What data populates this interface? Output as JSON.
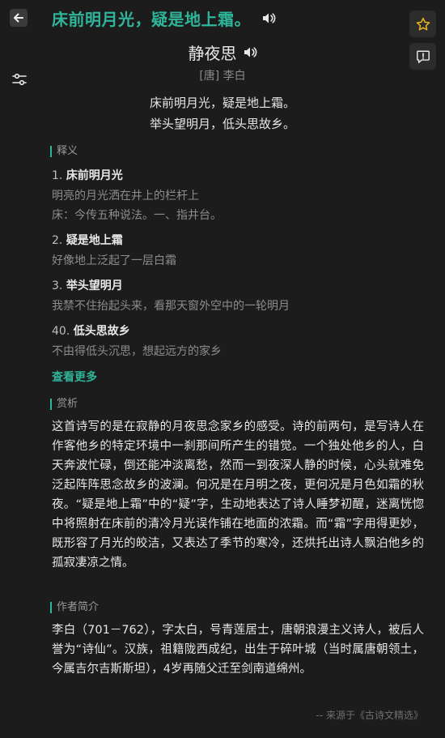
{
  "header": {
    "headline": "床前明月光，疑是地上霜。"
  },
  "poem": {
    "title": "静夜思",
    "author": "[唐] 李白",
    "lines": [
      "床前明月光，疑是地上霜。",
      "举头望明月，低头思故乡。"
    ]
  },
  "definitions": {
    "heading": "释义",
    "items": [
      {
        "num": "1.",
        "word": "床前明月光",
        "text": [
          "明亮的月光洒在井上的栏杆上",
          "床：今传五种说法。一、指井台。"
        ]
      },
      {
        "num": "2.",
        "word": "疑是地上霜",
        "text": [
          "好像地上泛起了一层白霜"
        ]
      },
      {
        "num": "3.",
        "word": "举头望明月",
        "text": [
          "我禁不住抬起头来，看那天窗外空中的一轮明月"
        ]
      },
      {
        "num": "40.",
        "word": "低头思故乡",
        "text": [
          "不由得低头沉思，想起远方的家乡"
        ]
      }
    ],
    "more_label": "查看更多"
  },
  "appreciation": {
    "heading": "赏析",
    "text": "这首诗写的是在寂静的月夜思念家乡的感受。诗的前两句，是写诗人在作客他乡的特定环境中一刹那间所产生的错觉。一个独处他乡的人，白天奔波忙碌，倒还能冲淡离愁，然而一到夜深人静的时候，心头就难免泛起阵阵思念故乡的波澜。何况是在月明之夜，更何况是月色如霜的秋夜。“疑是地上霜”中的“疑”字，生动地表达了诗人睡梦初醒，迷离恍惚中将照射在床前的清冷月光误作铺在地面的浓霜。而“霜”字用得更妙，既形容了月光的皎洁，又表达了季节的寒冷，还烘托出诗人飘泊他乡的孤寂凄凉之情。"
  },
  "author_intro": {
    "heading": "作者简介",
    "text": "李白（701－762），字太白，号青莲居士，唐朝浪漫主义诗人，被后人誉为“诗仙”。汉族，祖籍陇西成纪，出生于碎叶城（当时属唐朝领土，今属吉尔吉斯斯坦），4岁再随父迁至剑南道绵州。"
  },
  "footer": {
    "source": "-- 来源于《古诗文精选》"
  },
  "colors": {
    "accent": "#2fb59a",
    "star": "#e6b422",
    "background": "#1c1c1c"
  },
  "icons": [
    "back-arrow-icon",
    "speaker-icon",
    "star-icon",
    "report-icon",
    "filter-sliders-icon"
  ]
}
